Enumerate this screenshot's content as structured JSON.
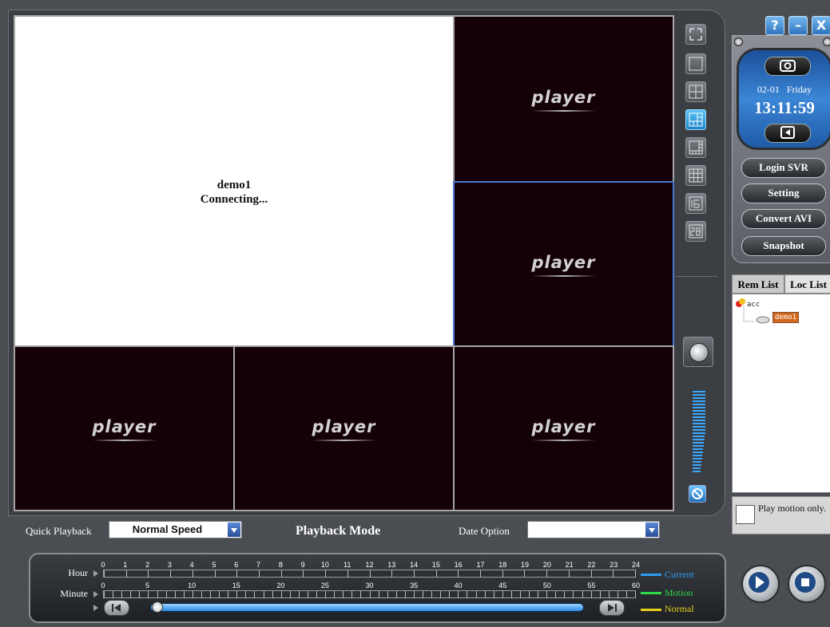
{
  "players": {
    "main": {
      "camera": "demo1",
      "status": "Connecting..."
    },
    "placeholder": "player"
  },
  "clock": {
    "date": "02-01",
    "day": "Friday",
    "time": "13:11:59"
  },
  "window_controls": {
    "help": "?",
    "minimize": "–",
    "close": "X"
  },
  "side_buttons": {
    "login": "Login SVR",
    "setting": "Setting",
    "convert": "Convert AVI",
    "snapshot": "Snapshot"
  },
  "list": {
    "tabs": [
      "Rem List",
      "Loc List"
    ],
    "root": "acc",
    "camera": "demo1"
  },
  "motion": {
    "label": "Play motion only."
  },
  "options": {
    "quick_label": "Quick Playback",
    "speed_value": "Normal Speed",
    "mode_label": "Playback Mode",
    "date_label": "Date Option",
    "date_value": ""
  },
  "timeline": {
    "hour_label": "Hour",
    "minute_label": "Minute",
    "hours": [
      "0",
      "1",
      "2",
      "3",
      "4",
      "5",
      "6",
      "7",
      "8",
      "9",
      "10",
      "11",
      "12",
      "13",
      "14",
      "15",
      "16",
      "17",
      "18",
      "19",
      "20",
      "21",
      "22",
      "23",
      "24"
    ],
    "minutes": [
      "0",
      "5",
      "10",
      "15",
      "20",
      "25",
      "30",
      "35",
      "40",
      "45",
      "50",
      "55",
      "60"
    ],
    "legend": [
      {
        "label": "Current",
        "color": "#2f9cf0"
      },
      {
        "label": "Motion",
        "color": "#2fd84b"
      },
      {
        "label": "Normal",
        "color": "#e8d21d"
      }
    ]
  },
  "colors": {
    "active_border": "#4a7bd4",
    "player_bg": "#140008"
  }
}
